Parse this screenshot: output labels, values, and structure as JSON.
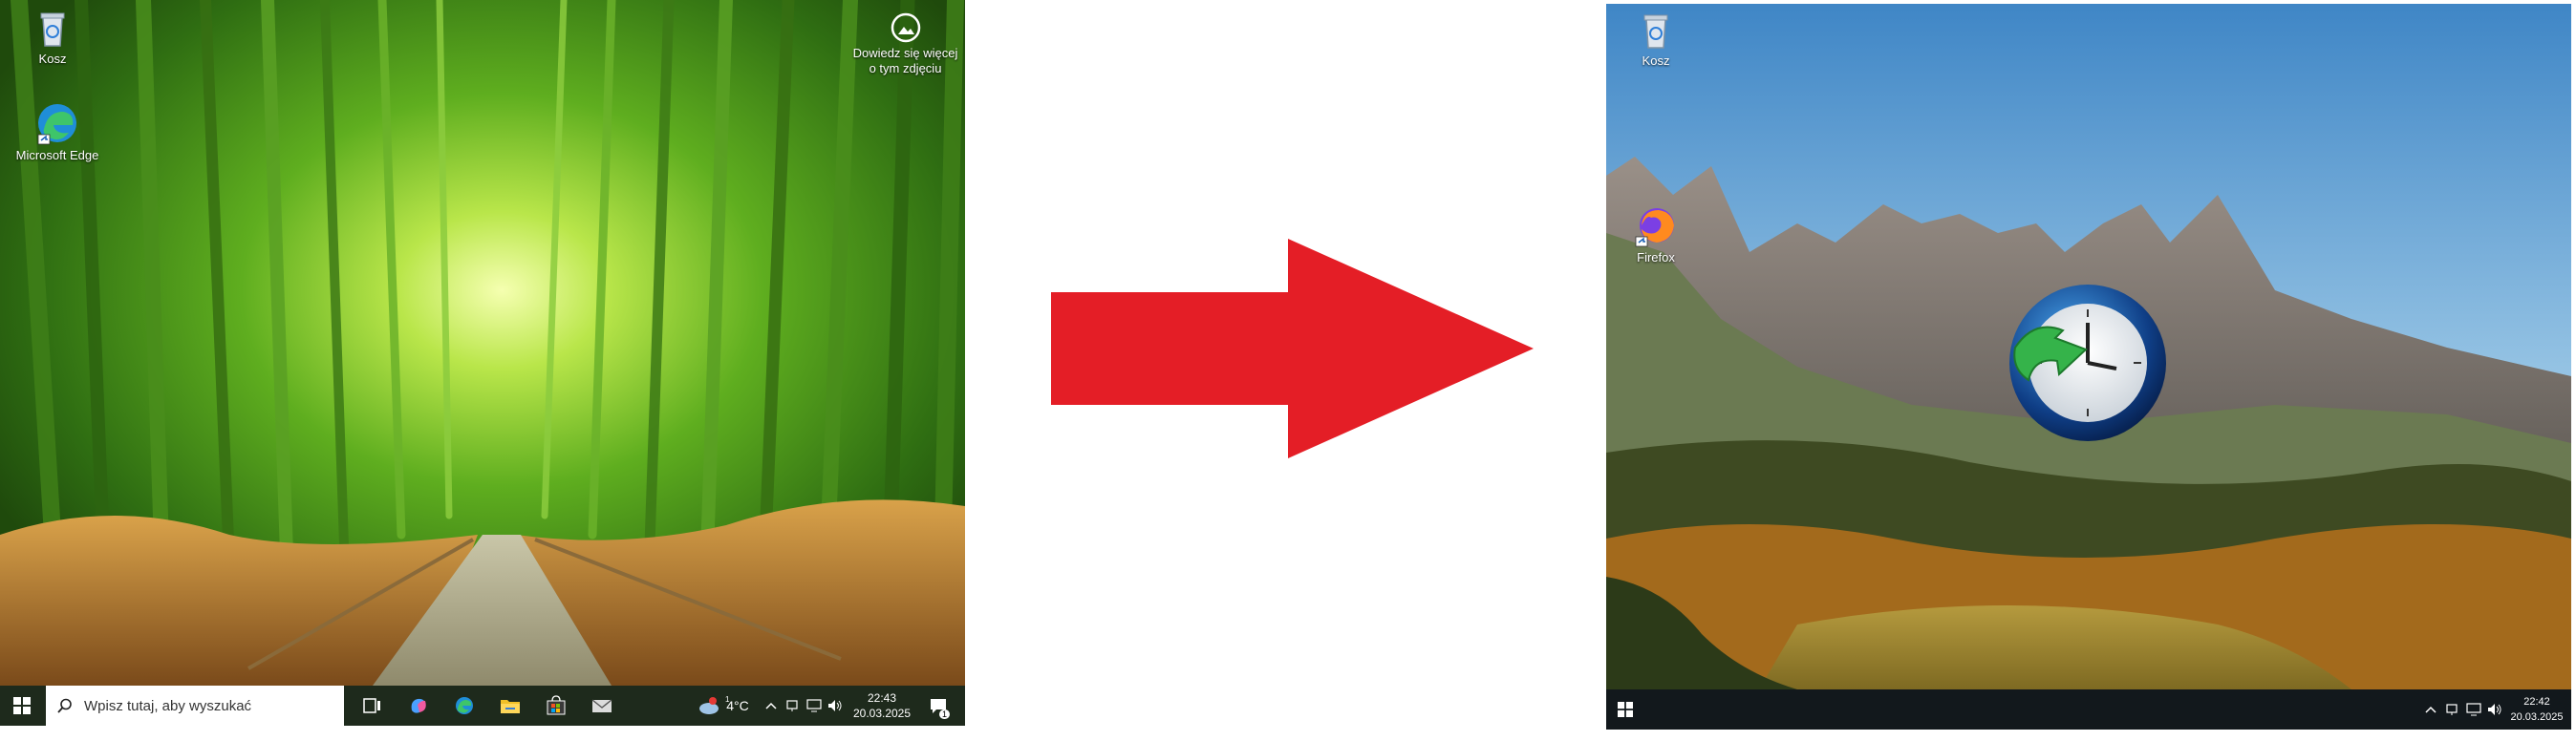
{
  "left_desktop": {
    "icons": {
      "recycle_bin": "Kosz",
      "edge": "Microsoft Edge",
      "learn_more": "Dowiedz się więcej o tym zdjęciu"
    },
    "taskbar": {
      "search_placeholder": "Wpisz tutaj, aby wyszukać",
      "weather_temp": "4°C",
      "time": "22:43",
      "date": "20.03.2025",
      "notification_count": "1",
      "weather_badge": "1"
    },
    "colors": {
      "taskbar": "#1e2a1c",
      "search_bg": "#ffffff"
    }
  },
  "right_desktop": {
    "icons": {
      "recycle_bin": "Kosz",
      "firefox": "Firefox"
    },
    "taskbar": {
      "time": "22:42",
      "date": "20.03.2025"
    },
    "colors": {
      "taskbar": "#12181c"
    }
  },
  "arrow": {
    "color": "#e41e26",
    "direction": "right"
  }
}
